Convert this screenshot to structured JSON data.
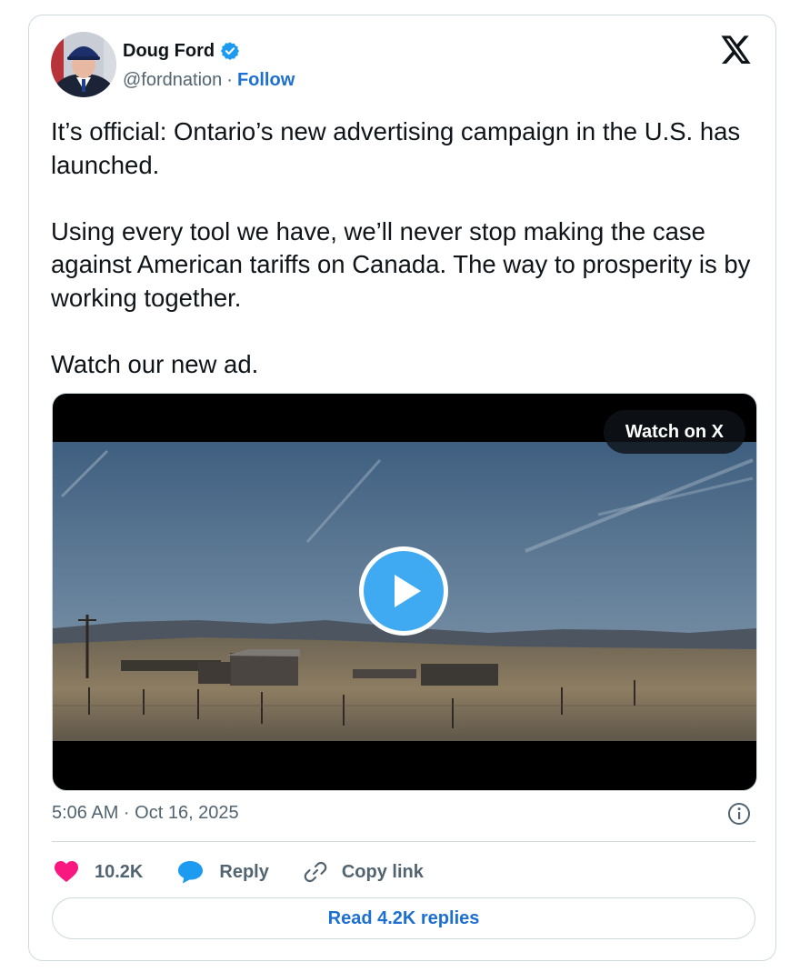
{
  "author": {
    "name": "Doug Ford",
    "handle": "@fordnation",
    "separator": "·",
    "follow_label": "Follow",
    "verified": true
  },
  "tweet": {
    "paragraphs": [
      "It’s official: Ontario’s new advertising campaign in the U.S. has launched.",
      "Using every tool we have, we’ll never stop making the case against American tariffs on Canada. The way to prosperity is by working together.",
      "Watch our new ad."
    ],
    "timestamp": "5:06 AM · Oct 16, 2025"
  },
  "media": {
    "watch_label": "Watch on X",
    "play_icon": "play-icon"
  },
  "actions": {
    "like_count": "10.2K",
    "reply_label": "Reply",
    "copy_label": "Copy link"
  },
  "replies_button": "Read 4.2K replies",
  "colors": {
    "accent": "#1d6fd1",
    "like": "#f91880",
    "reply_icon": "#1d9bf0",
    "muted": "#536471",
    "border": "#cfd9de"
  }
}
